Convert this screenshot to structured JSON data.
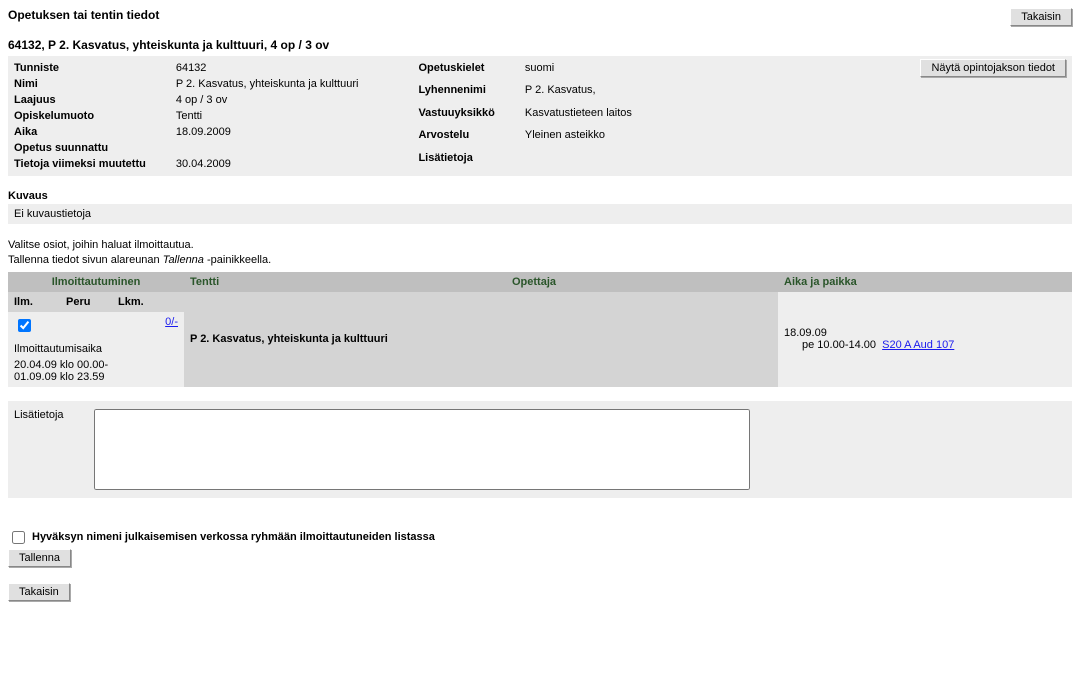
{
  "header": {
    "title": "Opetuksen tai tentin tiedot",
    "back_label": "Takaisin"
  },
  "course": {
    "heading": "64132, P 2. Kasvatus, yhteiskunta ja kulttuuri, 4 op / 3 ov",
    "show_details_label": "Näytä opintojakson tiedot",
    "labels": {
      "tunniste": "Tunniste",
      "nimi": "Nimi",
      "laajuus": "Laajuus",
      "opiskelumuoto": "Opiskelumuoto",
      "aika": "Aika",
      "opetus_suunnattu": "Opetus suunnattu",
      "tietoja_muutettu": "Tietoja viimeksi muutettu",
      "opetuskielet": "Opetuskielet",
      "lyhennenimi": "Lyhennenimi",
      "vastuuyksikko": "Vastuuyksikkö",
      "arvostelu": "Arvostelu",
      "lisatietoja": "Lisätietoja"
    },
    "values": {
      "tunniste": "64132",
      "nimi": "P 2. Kasvatus, yhteiskunta ja kulttuuri",
      "laajuus": "4 op / 3 ov",
      "opiskelumuoto": "Tentti",
      "aika": "18.09.2009",
      "opetus_suunnattu": "",
      "tietoja_muutettu": "30.04.2009",
      "opetuskielet": "suomi",
      "lyhennenimi": "P 2. Kasvatus,",
      "vastuuyksikko": "Kasvatustieteen laitos",
      "arvostelu": "Yleinen asteikko",
      "lisatietoja": ""
    }
  },
  "description": {
    "heading": "Kuvaus",
    "text": "Ei kuvaustietoja"
  },
  "instructions": {
    "line1": "Valitse osiot, joihin haluat ilmoittautua.",
    "line2a": "Tallenna tiedot sivun alareunan ",
    "line2b": "Tallenna",
    "line2c": " -painikkeella."
  },
  "reg_table": {
    "headers": {
      "ilmoittautuminen": "Ilmoittautuminen",
      "tentti": "Tentti",
      "opettaja": "Opettaja",
      "aika_paikka": "Aika ja paikka",
      "ilm": "Ilm.",
      "peru": "Peru",
      "lkm": "Lkm."
    },
    "row": {
      "tentti_name": "P 2. Kasvatus, yhteiskunta ja kulttuuri",
      "opettaja": "",
      "date": "18.09.09",
      "time": "pe 10.00-14.00",
      "room": "S20 A Aud 107",
      "count_link": "0/-"
    },
    "reg_period": {
      "label": "Ilmoittautumisaika",
      "start": "20.04.09 klo 00.00-",
      "end": "01.09.09 klo 23.59"
    }
  },
  "additional": {
    "label": "Lisätietoja",
    "value": ""
  },
  "consent": {
    "label": "Hyväksyn nimeni julkaisemisen verkossa ryhmään ilmoittautuneiden listassa"
  },
  "buttons": {
    "tallenna": "Tallenna",
    "takaisin": "Takaisin"
  }
}
